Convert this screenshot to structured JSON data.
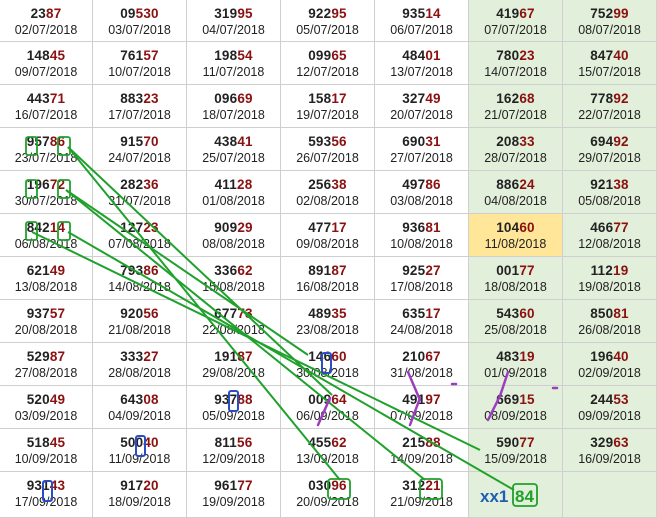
{
  "colors": {
    "green_col": "#e2efda",
    "highlight": "#ffe699",
    "red_digits": "#8b1010",
    "line_green": "#1fa12b",
    "box_blue": "#2b4dc4",
    "mark_purple": "#9b3fbf",
    "label_blue": "#1c5fb5"
  },
  "rows": [
    [
      [
        "23",
        "87",
        "02/07/2018"
      ],
      [
        "09",
        "530",
        "03/07/2018"
      ],
      [
        "319",
        "95",
        "04/07/2018"
      ],
      [
        "922",
        "95",
        "05/07/2018"
      ],
      [
        "935",
        "14",
        "06/07/2018"
      ],
      [
        "419",
        "67",
        "07/07/2018"
      ],
      [
        "752",
        "99",
        "08/07/2018"
      ]
    ],
    [
      [
        "148",
        "45",
        "09/07/2018"
      ],
      [
        "761",
        "57",
        "10/07/2018"
      ],
      [
        "198",
        "54",
        "11/07/2018"
      ],
      [
        "099",
        "65",
        "12/07/2018"
      ],
      [
        "484",
        "01",
        "13/07/2018"
      ],
      [
        "780",
        "23",
        "14/07/2018"
      ],
      [
        "847",
        "40",
        "15/07/2018"
      ]
    ],
    [
      [
        "443",
        "71",
        "16/07/2018"
      ],
      [
        "883",
        "23",
        "17/07/2018"
      ],
      [
        "096",
        "69",
        "18/07/2018"
      ],
      [
        "158",
        "17",
        "19/07/2018"
      ],
      [
        "327",
        "49",
        "20/07/2018"
      ],
      [
        "162",
        "68",
        "21/07/2018"
      ],
      [
        "778",
        "92",
        "22/07/2018"
      ]
    ],
    [
      [
        "957",
        "86",
        "23/07/2018"
      ],
      [
        "915",
        "70",
        "24/07/2018"
      ],
      [
        "438",
        "41",
        "25/07/2018"
      ],
      [
        "593",
        "56",
        "26/07/2018"
      ],
      [
        "690",
        "31",
        "27/07/2018"
      ],
      [
        "208",
        "33",
        "28/07/2018"
      ],
      [
        "694",
        "92",
        "29/07/2018"
      ]
    ],
    [
      [
        "196",
        "72",
        "30/07/2018"
      ],
      [
        "282",
        "36",
        "31/07/2018"
      ],
      [
        "411",
        "28",
        "01/08/2018"
      ],
      [
        "256",
        "38",
        "02/08/2018"
      ],
      [
        "497",
        "86",
        "03/08/2018"
      ],
      [
        "886",
        "24",
        "04/08/2018"
      ],
      [
        "921",
        "38",
        "05/08/2018"
      ]
    ],
    [
      [
        "842",
        "14",
        "06/08/2018"
      ],
      [
        "127",
        "23",
        "07/08/2018"
      ],
      [
        "909",
        "29",
        "08/08/2018"
      ],
      [
        "477",
        "17",
        "09/08/2018"
      ],
      [
        "936",
        "81",
        "10/08/2018"
      ],
      [
        "104",
        "60",
        "11/08/2018"
      ],
      [
        "466",
        "77",
        "12/08/2018"
      ]
    ],
    [
      [
        "621",
        "49",
        "13/08/2018"
      ],
      [
        "793",
        "86",
        "14/08/2018"
      ],
      [
        "336",
        "62",
        "15/08/2018"
      ],
      [
        "891",
        "87",
        "16/08/2018"
      ],
      [
        "925",
        "27",
        "17/08/2018"
      ],
      [
        "001",
        "77",
        "18/08/2018"
      ],
      [
        "112",
        "19",
        "19/08/2018"
      ]
    ],
    [
      [
        "937",
        "57",
        "20/08/2018"
      ],
      [
        "920",
        "56",
        "21/08/2018"
      ],
      [
        "677",
        "73",
        "22/08/2018"
      ],
      [
        "489",
        "35",
        "23/08/2018"
      ],
      [
        "635",
        "17",
        "24/08/2018"
      ],
      [
        "543",
        "60",
        "25/08/2018"
      ],
      [
        "850",
        "81",
        "26/08/2018"
      ]
    ],
    [
      [
        "529",
        "87",
        "27/08/2018"
      ],
      [
        "333",
        "27",
        "28/08/2018"
      ],
      [
        "191",
        "87",
        "29/08/2018"
      ],
      [
        "146",
        "60",
        "30/08/2018"
      ],
      [
        "210",
        "67",
        "31/08/2018"
      ],
      [
        "483",
        "19",
        "01/09/2018"
      ],
      [
        "196",
        "40",
        "02/09/2018"
      ]
    ],
    [
      [
        "520",
        "49",
        "03/09/2018"
      ],
      [
        "643",
        "08",
        "04/09/2018"
      ],
      [
        "937",
        "88",
        "05/09/2018"
      ],
      [
        "009",
        "64",
        "06/09/2018"
      ],
      [
        "491",
        "97",
        "07/09/2018"
      ],
      [
        "669",
        "15",
        "08/09/2018"
      ],
      [
        "244",
        "53",
        "09/09/2018"
      ]
    ],
    [
      [
        "518",
        "45",
        "10/09/2018"
      ],
      [
        "500",
        "40",
        "11/09/2018"
      ],
      [
        "811",
        "56",
        "12/09/2018"
      ],
      [
        "455",
        "62",
        "13/09/2018"
      ],
      [
        "215",
        "88",
        "14/09/2018"
      ],
      [
        "590",
        "77",
        "15/09/2018"
      ],
      [
        "329",
        "63",
        "16/09/2018"
      ]
    ],
    [
      [
        "931",
        "43",
        "17/09/2018"
      ],
      [
        "917",
        "20",
        "18/09/2018"
      ],
      [
        "961",
        "77",
        "19/09/2018"
      ],
      [
        "030",
        "96",
        "20/09/2018"
      ],
      [
        "312",
        "21",
        "21/09/2018"
      ],
      [
        "",
        "",
        " "
      ],
      [
        "",
        "",
        " "
      ]
    ]
  ],
  "highlight_cell": "10460",
  "annotation": {
    "prefix": "xx1",
    "result": "84"
  }
}
